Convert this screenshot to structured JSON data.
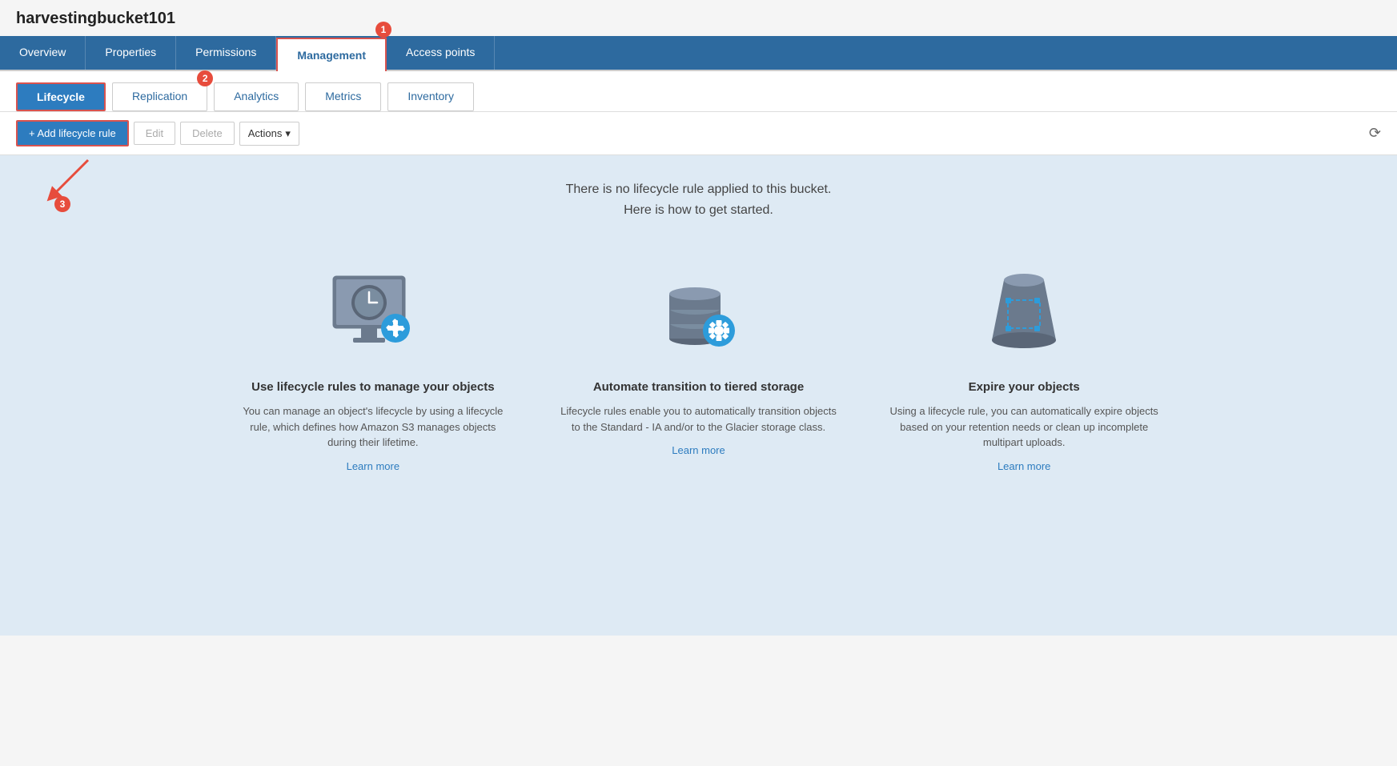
{
  "page": {
    "title": "harvestingbucket101"
  },
  "topTabs": {
    "tabs": [
      {
        "id": "overview",
        "label": "Overview",
        "active": false
      },
      {
        "id": "properties",
        "label": "Properties",
        "active": false
      },
      {
        "id": "permissions",
        "label": "Permissions",
        "active": false
      },
      {
        "id": "management",
        "label": "Management",
        "active": true
      },
      {
        "id": "access-points",
        "label": "Access points",
        "active": false
      }
    ]
  },
  "subTabs": {
    "tabs": [
      {
        "id": "lifecycle",
        "label": "Lifecycle",
        "active": true
      },
      {
        "id": "replication",
        "label": "Replication",
        "active": false
      },
      {
        "id": "analytics",
        "label": "Analytics",
        "active": false
      },
      {
        "id": "metrics",
        "label": "Metrics",
        "active": false
      },
      {
        "id": "inventory",
        "label": "Inventory",
        "active": false
      }
    ]
  },
  "toolbar": {
    "addLabel": "+ Add lifecycle rule",
    "editLabel": "Edit",
    "deleteLabel": "Delete",
    "actionsLabel": "Actions",
    "chevron": "▾"
  },
  "emptyState": {
    "line1": "There is no lifecycle rule applied to this bucket.",
    "line2": "Here is how to get started."
  },
  "featureCards": [
    {
      "id": "lifecycle-rules",
      "title": "Use lifecycle rules to manage your objects",
      "description": "You can manage an object's lifecycle by using a lifecycle rule, which defines how Amazon S3 manages objects during their lifetime.",
      "learnMore": "Learn more"
    },
    {
      "id": "tiered-storage",
      "title": "Automate transition to tiered storage",
      "description": "Lifecycle rules enable you to automatically transition objects to the Standard - IA and/or to the Glacier storage class.",
      "learnMore": "Learn more"
    },
    {
      "id": "expire-objects",
      "title": "Expire your objects",
      "description": "Using a lifecycle rule, you can automatically expire objects based on your retention needs or clean up incomplete multipart uploads.",
      "learnMore": "Learn more"
    }
  ],
  "annotations": {
    "one": "1",
    "two": "2",
    "three": "3"
  },
  "colors": {
    "primary": "#2d7cbf",
    "red": "#d9534f",
    "annotationRed": "#e74c3c"
  }
}
